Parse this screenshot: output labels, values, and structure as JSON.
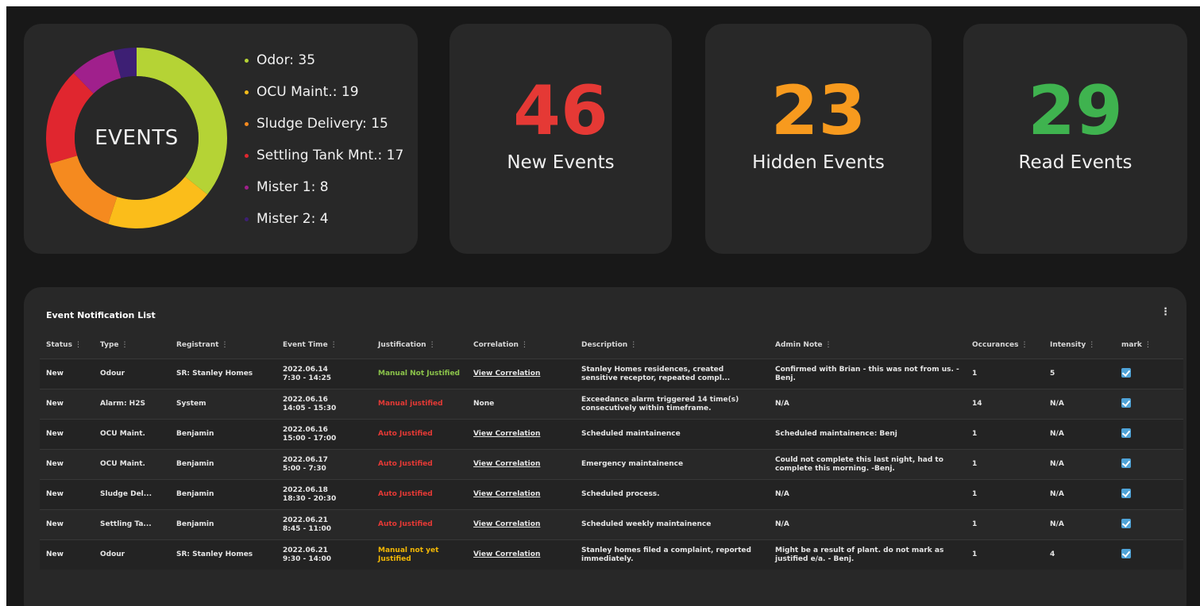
{
  "donut": {
    "center_label": "EVENTS",
    "segments": [
      {
        "label": "Odor: 35",
        "value": 35,
        "color": "#b5d335"
      },
      {
        "label": "OCU Maint.: 19",
        "value": 19,
        "color": "#fbbd1a"
      },
      {
        "label": "Sludge Delivery: 15",
        "value": 15,
        "color": "#f58a1f"
      },
      {
        "label": "Settling Tank Mnt.: 17",
        "value": 17,
        "color": "#e0262f"
      },
      {
        "label": "Mister 1: 8",
        "value": 8,
        "color": "#a0208c"
      },
      {
        "label": "Mister 2: 4",
        "value": 4,
        "color": "#3d1f74"
      }
    ]
  },
  "stats": {
    "new": {
      "value": "46",
      "label": "New Events",
      "color": "#e53935"
    },
    "hidden": {
      "value": "23",
      "label": "Hidden Events",
      "color": "#f79a1e"
    },
    "read": {
      "value": "29",
      "label": "Read Events",
      "color": "#3fb34f"
    }
  },
  "table": {
    "title": "Event Notification List",
    "menu_icon": "⋮",
    "columns": [
      "Status",
      "Type",
      "Registrant",
      "Event Time",
      "Justification",
      "Correlation",
      "Description",
      "Admin Note",
      "Occurances",
      "Intensity",
      "mark"
    ],
    "rows": [
      {
        "status": "New",
        "type": "Odour",
        "registrant": "SR: Stanley Homes",
        "time1": "2022.06.14",
        "time2": "7:30 - 14:25",
        "justification": "Manual Not Justified",
        "just_class": "just-green",
        "correlation": "View Correlation",
        "corr_link": true,
        "description": "Stanley Homes residences, created sensitive receptor, repeated compl...",
        "admin_note": "Confirmed with Brian - this was not from us. - Benj.",
        "occurances": "1",
        "intensity": "5"
      },
      {
        "status": "New",
        "type": "Alarm: H2S",
        "registrant": "System",
        "time1": "2022.06.16",
        "time2": "14:05 - 15:30",
        "justification": "Manual justified",
        "just_class": "just-red",
        "correlation": "None",
        "corr_link": false,
        "description": "Exceedance alarm triggered 14 time(s) consecutively within timeframe.",
        "admin_note": "N/A",
        "occurances": "14",
        "intensity": "N/A"
      },
      {
        "status": "New",
        "type": "OCU Maint.",
        "registrant": "Benjamin",
        "time1": "2022.06.16",
        "time2": "15:00 - 17:00",
        "justification": "Auto Justified",
        "just_class": "just-red",
        "correlation": "View Correlation",
        "corr_link": true,
        "description": "Scheduled maintainence",
        "admin_note": "Scheduled maintainence: Benj",
        "occurances": "1",
        "intensity": "N/A"
      },
      {
        "status": "New",
        "type": "OCU Maint.",
        "registrant": "Benjamin",
        "time1": "2022.06.17",
        "time2": "5:00 - 7:30",
        "justification": "Auto Justified",
        "just_class": "just-red",
        "correlation": "View Correlation",
        "corr_link": true,
        "description": "Emergency maintainence",
        "admin_note": "Could not complete this last night, had to complete this morning. -Benj.",
        "occurances": "1",
        "intensity": "N/A"
      },
      {
        "status": "New",
        "type": "Sludge Del...",
        "registrant": "Benjamin",
        "time1": "2022.06.18",
        "time2": "18:30 - 20:30",
        "justification": "Auto Justified",
        "just_class": "just-red",
        "correlation": "View Correlation",
        "corr_link": true,
        "description": "Scheduled process.",
        "admin_note": "N/A",
        "occurances": "1",
        "intensity": "N/A"
      },
      {
        "status": "New",
        "type": "Settling Ta...",
        "registrant": "Benjamin",
        "time1": "2022.06.21",
        "time2": "8:45 - 11:00",
        "justification": "Auto Justified",
        "just_class": "just-red",
        "correlation": "View Correlation",
        "corr_link": true,
        "description": "Scheduled weekly maintainence",
        "admin_note": "N/A",
        "occurances": "1",
        "intensity": "N/A"
      },
      {
        "status": "New",
        "type": "Odour",
        "registrant": "SR: Stanley Homes",
        "time1": "2022.06.21",
        "time2": "9:30 - 14:00",
        "justification": "Manual not yet Justified",
        "just_class": "just-yellow",
        "correlation": "View Correlation",
        "corr_link": true,
        "description": "Stanley homes filed a complaint, reported immediately.",
        "admin_note": "Might be a result of plant. do not mark as justified e/a. - Benj.",
        "occurances": "1",
        "intensity": "4"
      }
    ]
  }
}
